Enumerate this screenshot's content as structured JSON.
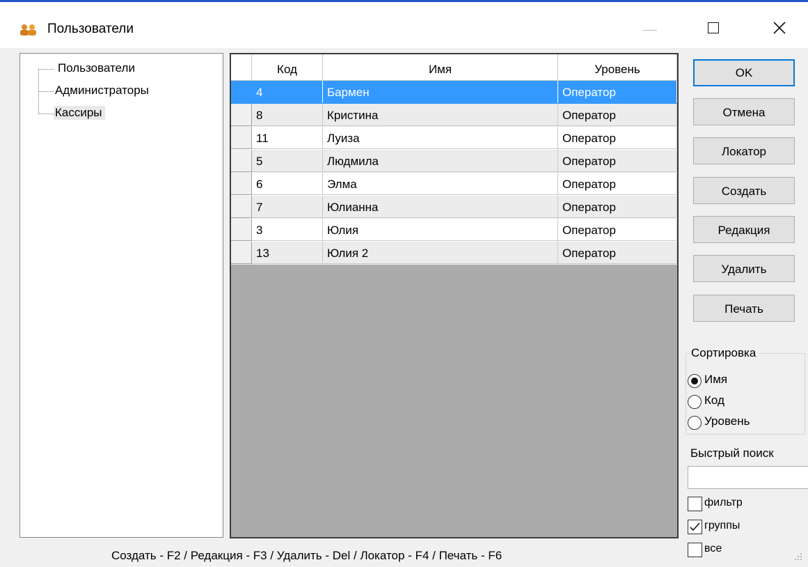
{
  "window": {
    "title": "Пользователи",
    "icon": "users-icon",
    "controls": [
      "minimize-icon",
      "maximize-icon",
      "close-icon"
    ]
  },
  "tree": {
    "items": [
      {
        "label": "Пользователи",
        "selected": false
      },
      {
        "label": "Администраторы",
        "selected": false
      },
      {
        "label": "Кассиры",
        "selected": true
      }
    ]
  },
  "grid": {
    "columns": [
      "Код",
      "Имя",
      "Уровень"
    ],
    "rows": [
      {
        "code": "4",
        "name": "Бармен",
        "level": "Оператор",
        "selected": true
      },
      {
        "code": "8",
        "name": "Кристина",
        "level": "Оператор",
        "selected": false
      },
      {
        "code": "11",
        "name": "Луиза",
        "level": "Оператор",
        "selected": false
      },
      {
        "code": "5",
        "name": "Людмила",
        "level": "Оператор",
        "selected": false
      },
      {
        "code": "6",
        "name": "Элма",
        "level": "Оператор",
        "selected": false
      },
      {
        "code": "7",
        "name": "Юлианна",
        "level": "Оператор",
        "selected": false
      },
      {
        "code": "3",
        "name": "Юлия",
        "level": "Оператор",
        "selected": false
      },
      {
        "code": "13",
        "name": "Юлия 2",
        "level": "Оператор",
        "selected": false
      }
    ]
  },
  "buttons": {
    "ok": "OK",
    "cancel": "Отмена",
    "locator": "Локатор",
    "create": "Создать",
    "edit": "Редакция",
    "delete": "Удалить",
    "print": "Печать"
  },
  "sort": {
    "title": "Сортировка",
    "options": [
      {
        "label": "Имя",
        "checked": true
      },
      {
        "label": "Код",
        "checked": false
      },
      {
        "label": "Уровень",
        "checked": false
      }
    ]
  },
  "quick_search": {
    "label": "Быстрый поиск",
    "value": ""
  },
  "checkboxes": [
    {
      "label": "фильтр",
      "checked": false
    },
    {
      "label": "группы",
      "checked": true
    },
    {
      "label": "все",
      "checked": false
    }
  ],
  "status_bar": "Создать - F2 / Редакция - F3 / Удалить - Del / Локатор - F4 / Печать - F6",
  "colors": {
    "selection": "#3399ff",
    "default_button_border": "#0078d7",
    "grid_empty_area": "#ababab"
  }
}
